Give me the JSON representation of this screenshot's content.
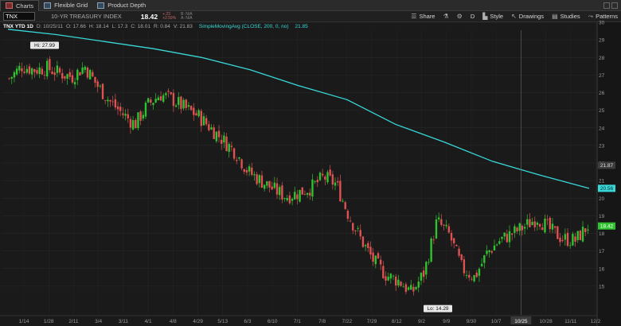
{
  "tabs": [
    {
      "label": "Charts",
      "active": true,
      "icon": "chart-icon"
    },
    {
      "label": "Flexible Grid",
      "active": false,
      "icon": "grid-icon"
    },
    {
      "label": "Product Depth",
      "active": false,
      "icon": "depth-icon"
    }
  ],
  "toolbar": {
    "symbol": "TNX",
    "description": "10-YR TREASURY INDEX",
    "last": "18.42",
    "change": "+.23",
    "change_pct": "+2.59%",
    "bid": "B: N/A",
    "ask": "A: N/A",
    "share_label": "Share",
    "period_label": "D",
    "style_label": "Style",
    "drawings_label": "Drawings",
    "studies_label": "Studies",
    "patterns_label": "Patterns"
  },
  "infobar": {
    "ticker_label": "TNX YTD 1D",
    "date": "D: 10/25/11",
    "open": "O: 17.66",
    "high": "H: 18.14",
    "low": "L: 17.3",
    "close": "C: 18.01",
    "range": "R: 0.84",
    "value": "V: 21.83",
    "study": "SimpleMovingAvg (CLOSE, 200, 0, no)",
    "study_value": "21.85"
  },
  "colors": {
    "up": "#2fc42f",
    "down": "#e05252",
    "sma": "#38d8d8",
    "background": "#1a1a1a",
    "grid": "#2a2a2a"
  },
  "chart_data": {
    "type": "candlestick",
    "symbol": "TNX",
    "ylim": [
      14,
      30
    ],
    "y_ticks": [
      15,
      16,
      17,
      18,
      19,
      20,
      21,
      22,
      23,
      24,
      25,
      26,
      27,
      28,
      29,
      30
    ],
    "x_tick_labels": [
      "1/14",
      "1/28",
      "2/11",
      "3/4",
      "3/11",
      "4/1",
      "4/8",
      "4/29",
      "5/13",
      "6/3",
      "6/10",
      "7/1",
      "7/8",
      "7/22",
      "7/29",
      "8/12",
      "9/2",
      "9/9",
      "9/30",
      "10/7",
      "10/25",
      "10/28",
      "11/11",
      "12/2"
    ],
    "high_label": "Hi: 27.99",
    "low_label": "Lo: 14.29",
    "axis_markers": {
      "prev_level": "21.87",
      "sma_last": "20.56",
      "last_price": "18.42"
    },
    "cursor_date": "10/25",
    "close_path": [
      [
        "1/14",
        26.8
      ],
      [
        "1/21",
        27.5
      ],
      [
        "1/28",
        27.3
      ],
      [
        "2/4",
        27.4
      ],
      [
        "2/11",
        27.1
      ],
      [
        "2/25",
        26.9
      ],
      [
        "3/4",
        27.5
      ],
      [
        "3/11",
        26.4
      ],
      [
        "3/18",
        25.5
      ],
      [
        "3/25",
        24.8
      ],
      [
        "4/1",
        24.2
      ],
      [
        "4/8",
        25.3
      ],
      [
        "4/15",
        25.9
      ],
      [
        "4/22",
        25.6
      ],
      [
        "4/29",
        25.1
      ],
      [
        "5/6",
        24.7
      ],
      [
        "5/13",
        24.0
      ],
      [
        "5/20",
        23.3
      ],
      [
        "5/27",
        22.6
      ],
      [
        "6/3",
        21.5
      ],
      [
        "6/10",
        21.0
      ],
      [
        "6/17",
        20.5
      ],
      [
        "6/24",
        20.1
      ],
      [
        "7/1",
        20.3
      ],
      [
        "7/8",
        20.6
      ],
      [
        "7/15",
        21.2
      ],
      [
        "7/22",
        20.8
      ],
      [
        "7/29",
        19.0
      ],
      [
        "8/5",
        17.6
      ],
      [
        "8/12",
        16.4
      ],
      [
        "8/19",
        15.6
      ],
      [
        "8/26",
        15.3
      ],
      [
        "9/2",
        14.6
      ],
      [
        "9/9",
        15.8
      ],
      [
        "9/16",
        18.7
      ],
      [
        "9/23",
        17.9
      ],
      [
        "9/30",
        16.0
      ],
      [
        "10/7",
        15.5
      ],
      [
        "10/14",
        16.9
      ],
      [
        "10/21",
        17.6
      ],
      [
        "10/28",
        18.0
      ],
      [
        "11/4",
        18.4
      ],
      [
        "11/11",
        18.9
      ],
      [
        "11/18",
        18.2
      ],
      [
        "11/25",
        17.7
      ],
      [
        "12/2",
        17.6
      ],
      [
        "12/6",
        18.42
      ]
    ],
    "sma_path": [
      [
        "1/14",
        29.6
      ],
      [
        "2/11",
        29.3
      ],
      [
        "3/11",
        28.9
      ],
      [
        "4/8",
        28.5
      ],
      [
        "5/13",
        28.0
      ],
      [
        "6/10",
        27.3
      ],
      [
        "7/8",
        26.4
      ],
      [
        "7/29",
        25.6
      ],
      [
        "9/2",
        24.2
      ],
      [
        "9/30",
        23.2
      ],
      [
        "10/28",
        22.1
      ],
      [
        "11/25",
        21.3
      ],
      [
        "12/6",
        20.56
      ]
    ]
  }
}
